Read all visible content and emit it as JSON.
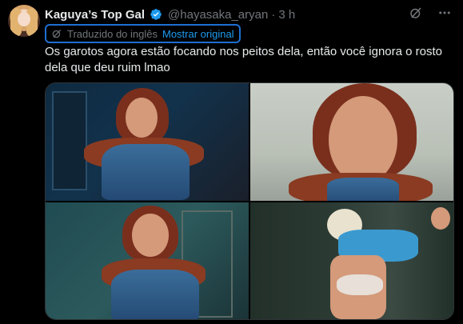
{
  "post": {
    "display_name": "Kaguya’s Top Gal",
    "handle": "@hayasaka_aryan",
    "separator": "·",
    "time": "3 h",
    "translation": {
      "label": "Traduzido do inglês",
      "link": "Mostrar original"
    },
    "text": "Os garotos agora estão focando nos peitos dela, então você ignora o rosto dela que deu ruim lmao"
  },
  "icons": {
    "verified": "verified-badge-icon",
    "grok": "grok-icon",
    "more": "more-icon",
    "translate": "translate-icon"
  },
  "colors": {
    "background": "#000000",
    "text": "#e7e9ea",
    "muted": "#71767b",
    "link": "#1d9bf0",
    "highlight_border": "#1d6fd1"
  },
  "media": [
    {
      "label": "image-1"
    },
    {
      "label": "image-2"
    },
    {
      "label": "image-3"
    },
    {
      "label": "image-4"
    }
  ]
}
